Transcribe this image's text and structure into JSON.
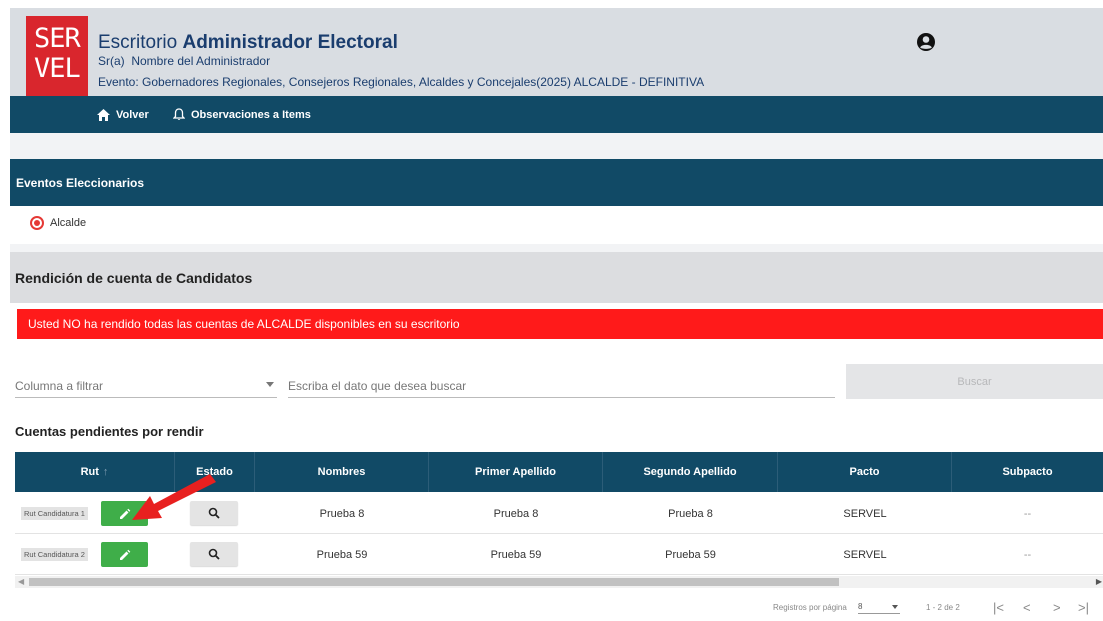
{
  "header": {
    "logo_line1": "SER",
    "logo_line2": "VEL",
    "title_prefix": "Escritorio",
    "title_bold": "Administrador Electoral",
    "user_prefix": "Sr(a)",
    "user_name": "Nombre del Administrador",
    "event": "Evento: Gobernadores Regionales, Consejeros Regionales, Alcaldes y Concejales(2025) ALCALDE - DEFINITIVA",
    "user_icon": "user-circle-icon"
  },
  "nav": {
    "back_label": "Volver",
    "back_icon": "home-icon",
    "observations_label": "Observaciones a Items",
    "observations_icon": "bell-icon"
  },
  "eventos": {
    "title": "Eventos Eleccionarios",
    "option_label": "Alcalde",
    "selected": true
  },
  "rendicion": {
    "title": "Rendición de cuenta de Candidatos",
    "alert": "Usted NO ha rendido todas las cuentas de ALCALDE disponibles en su escritorio"
  },
  "filter": {
    "column_placeholder": "Columna a filtrar",
    "search_placeholder": "Escriba el dato que desea buscar",
    "search_button": "Buscar"
  },
  "pending": {
    "title": "Cuentas pendientes por rendir",
    "columns": [
      "Rut",
      "Estado",
      "Nombres",
      "Primer Apellido",
      "Segundo Apellido",
      "Pacto",
      "Subpacto"
    ],
    "sort_indicator": "↑",
    "rows": [
      {
        "rut": "Rut Candidatura 1",
        "nombres": "Prueba 8",
        "primer_apellido": "Prueba 8",
        "segundo_apellido": "Prueba 8",
        "pacto": "SERVEL",
        "subpacto": "--"
      },
      {
        "rut": "Rut Candidatura 2",
        "nombres": "Prueba 59",
        "primer_apellido": "Prueba 59",
        "segundo_apellido": "Prueba 59",
        "pacto": "SERVEL",
        "subpacto": "--"
      }
    ]
  },
  "pagination": {
    "per_page_label": "Registros por página",
    "per_page_value": "8",
    "range": "1 - 2 de 2",
    "first": "|<",
    "prev": "<",
    "next": ">",
    "last": ">|"
  },
  "colors": {
    "brand_red": "#d9262d",
    "header_bg": "#d9dde2",
    "nav_bg": "#114a66",
    "alert_red": "#ff1a1a",
    "edit_green": "#3fae49"
  }
}
